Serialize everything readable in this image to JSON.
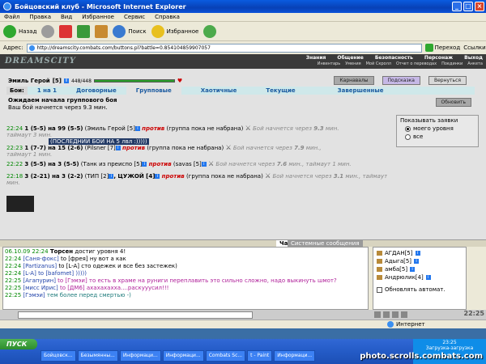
{
  "window": {
    "title": "Бойцовский клуб - Microsoft Internet Explorer"
  },
  "menu": [
    "Файл",
    "Правка",
    "Вид",
    "Избранное",
    "Сервис",
    "Справка"
  ],
  "toolbar": {
    "back": "Назад",
    "search": "Поиск",
    "favorites": "Избранное"
  },
  "address": {
    "label": "Адрес:",
    "url": "http://dreamscity.combats.com/buttons.pl?battle=0.854104859907057",
    "go": "Переход",
    "links": "Ссылки"
  },
  "site": {
    "logo": "DREAMSCITY",
    "nav": [
      "Знания",
      "Общение",
      "Безопасность",
      "Персонаж",
      "Выход"
    ],
    "subnav": [
      "Инвентарь",
      "Умения",
      "Мой Скролл",
      "Отчет о переводах",
      "Поединки",
      "Анкета"
    ]
  },
  "player": {
    "name": "Эмиль Герой",
    "level": "[5]",
    "hp": "448/448"
  },
  "buttons": {
    "karnavals": "Карнавалы",
    "hint": "Подсказка",
    "back": "Вернуться",
    "refresh": "Обновить"
  },
  "tabs": {
    "label": "Бои:",
    "items": [
      "1 на 1",
      "Договорные",
      "Групповые",
      "Хаотичные",
      "Текущие",
      "Завершенные"
    ]
  },
  "wait": {
    "title": "Ожидаем начала группового боя",
    "subtitle": "Ваш бой начнется через 9.3 мин."
  },
  "battles": [
    {
      "time": "22:24",
      "left": "1 (5-5) на 99 (5-5)",
      "who": "(Эмиль Герой [5]",
      "against": "против",
      "right": "(группа пока не набрана)",
      "start": "Бой начнется через",
      "mins": "9.3",
      "unit": "мин.",
      "extra": "таймаут 3 мин.",
      "comment": "(ПОСЛЕДНИЙ БОЙ НА 5 лвл :)))))"
    },
    {
      "time": "22:23",
      "left": "1 (7-7) на 15 (2-6)",
      "who": "(Pilsner [7]",
      "against": "против",
      "right": "(группа пока не набрана)",
      "start": "Бой начнется через",
      "mins": "7.9",
      "unit": "мин.,",
      "extra": "таймаут 1 мин."
    },
    {
      "time": "22:22",
      "left": "3 (5-5) на 3 (5-5)",
      "who": "(Танк из преиспо [5]",
      "against": "против",
      "right": "(savas [5]",
      "start": "Бой начнется через",
      "mins": "7.6",
      "unit": "мин., таймаут 1 мин."
    },
    {
      "time": "22:18",
      "left": "3 (2-21) на 3 (2-2)",
      "who": "(ТИП [2]",
      "mid": ", ЦУЖОЙ [4]",
      "against": "против",
      "right": "(группа пока не набрана)",
      "start": "Бой начнется через",
      "mins": "3.1",
      "unit": "мин., таймаут 3",
      "extra": "мин."
    }
  ],
  "options": {
    "title": "Показывать заявки",
    "opt1": "моего уровня",
    "opt2": "все"
  },
  "chat": {
    "tab_chat": "Чат",
    "tab_sys": "Системные сообщения",
    "lines": [
      {
        "ts": "06.10.09 22:24",
        "nick": "Торсен",
        "text": "достиг уровня 4!"
      },
      {
        "ts": "22:24",
        "nick": "[Саня-фокс]",
        "text": "to [фрея] ну вот а как"
      },
      {
        "ts": "22:24",
        "nick": "[Partizanus]",
        "text": "to [L-A] сто одежек и все без застежек)"
      },
      {
        "ts": "22:24",
        "nick": "[L-A]",
        "text": "to [bafomet] )))))"
      },
      {
        "ts": "22:25",
        "nick": "[Агапурин]",
        "text": "to [Гэмэи] то есть в храме на руниги переплавить это сильно сложно, надо выкинуть шмот?"
      },
      {
        "ts": "22:25",
        "nick": "[мисс Ирис]",
        "text": "to [ДМ6] ахахахахха....раскууусил!!!"
      },
      {
        "ts": "22:25",
        "nick": "[Гэмэи]",
        "text": "тем более перед смертью -)"
      }
    ]
  },
  "users": [
    "АГДАН[5]",
    "Адыга[5]",
    "амба[5]",
    "Андрюлик[4]"
  ],
  "auto_update": "Обновлять автомат.",
  "clock": "22:25",
  "status": {
    "zone": "Интернет"
  },
  "taskbar": {
    "start": "ПУСК",
    "tasks": [
      "Бойцовск...",
      "Безымянны...",
      "Информаци...",
      "Информаци...",
      "Combats Sc...",
      "t - Paint",
      "Информаци..."
    ],
    "time": "23:25",
    "tray_text": "Загрузка-загрузка"
  },
  "watermark": "photo.scrolls.combats.com",
  "colors": {
    "accent": "#1a5aa0",
    "battle_red": "#cc0000",
    "time_green": "#008800"
  }
}
